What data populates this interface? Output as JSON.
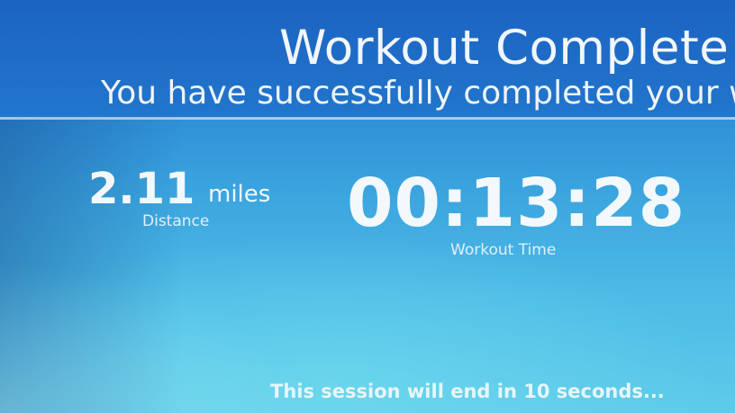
{
  "header": {
    "title": "Workout Complete",
    "subtitle": "You have successfully completed your w"
  },
  "stats": {
    "distance": {
      "value": "2.11",
      "unit": "miles",
      "label": "Distance"
    },
    "workout_time": {
      "value": "00:13:28",
      "label": "Workout Time"
    }
  },
  "footer": {
    "session_message": "This session will end in 10 seconds..."
  },
  "colors": {
    "header_blue": "#1c63c2",
    "body_blue": "#3aa3de",
    "light_cyan": "#5ecbea",
    "text": "#f2f8fc"
  }
}
